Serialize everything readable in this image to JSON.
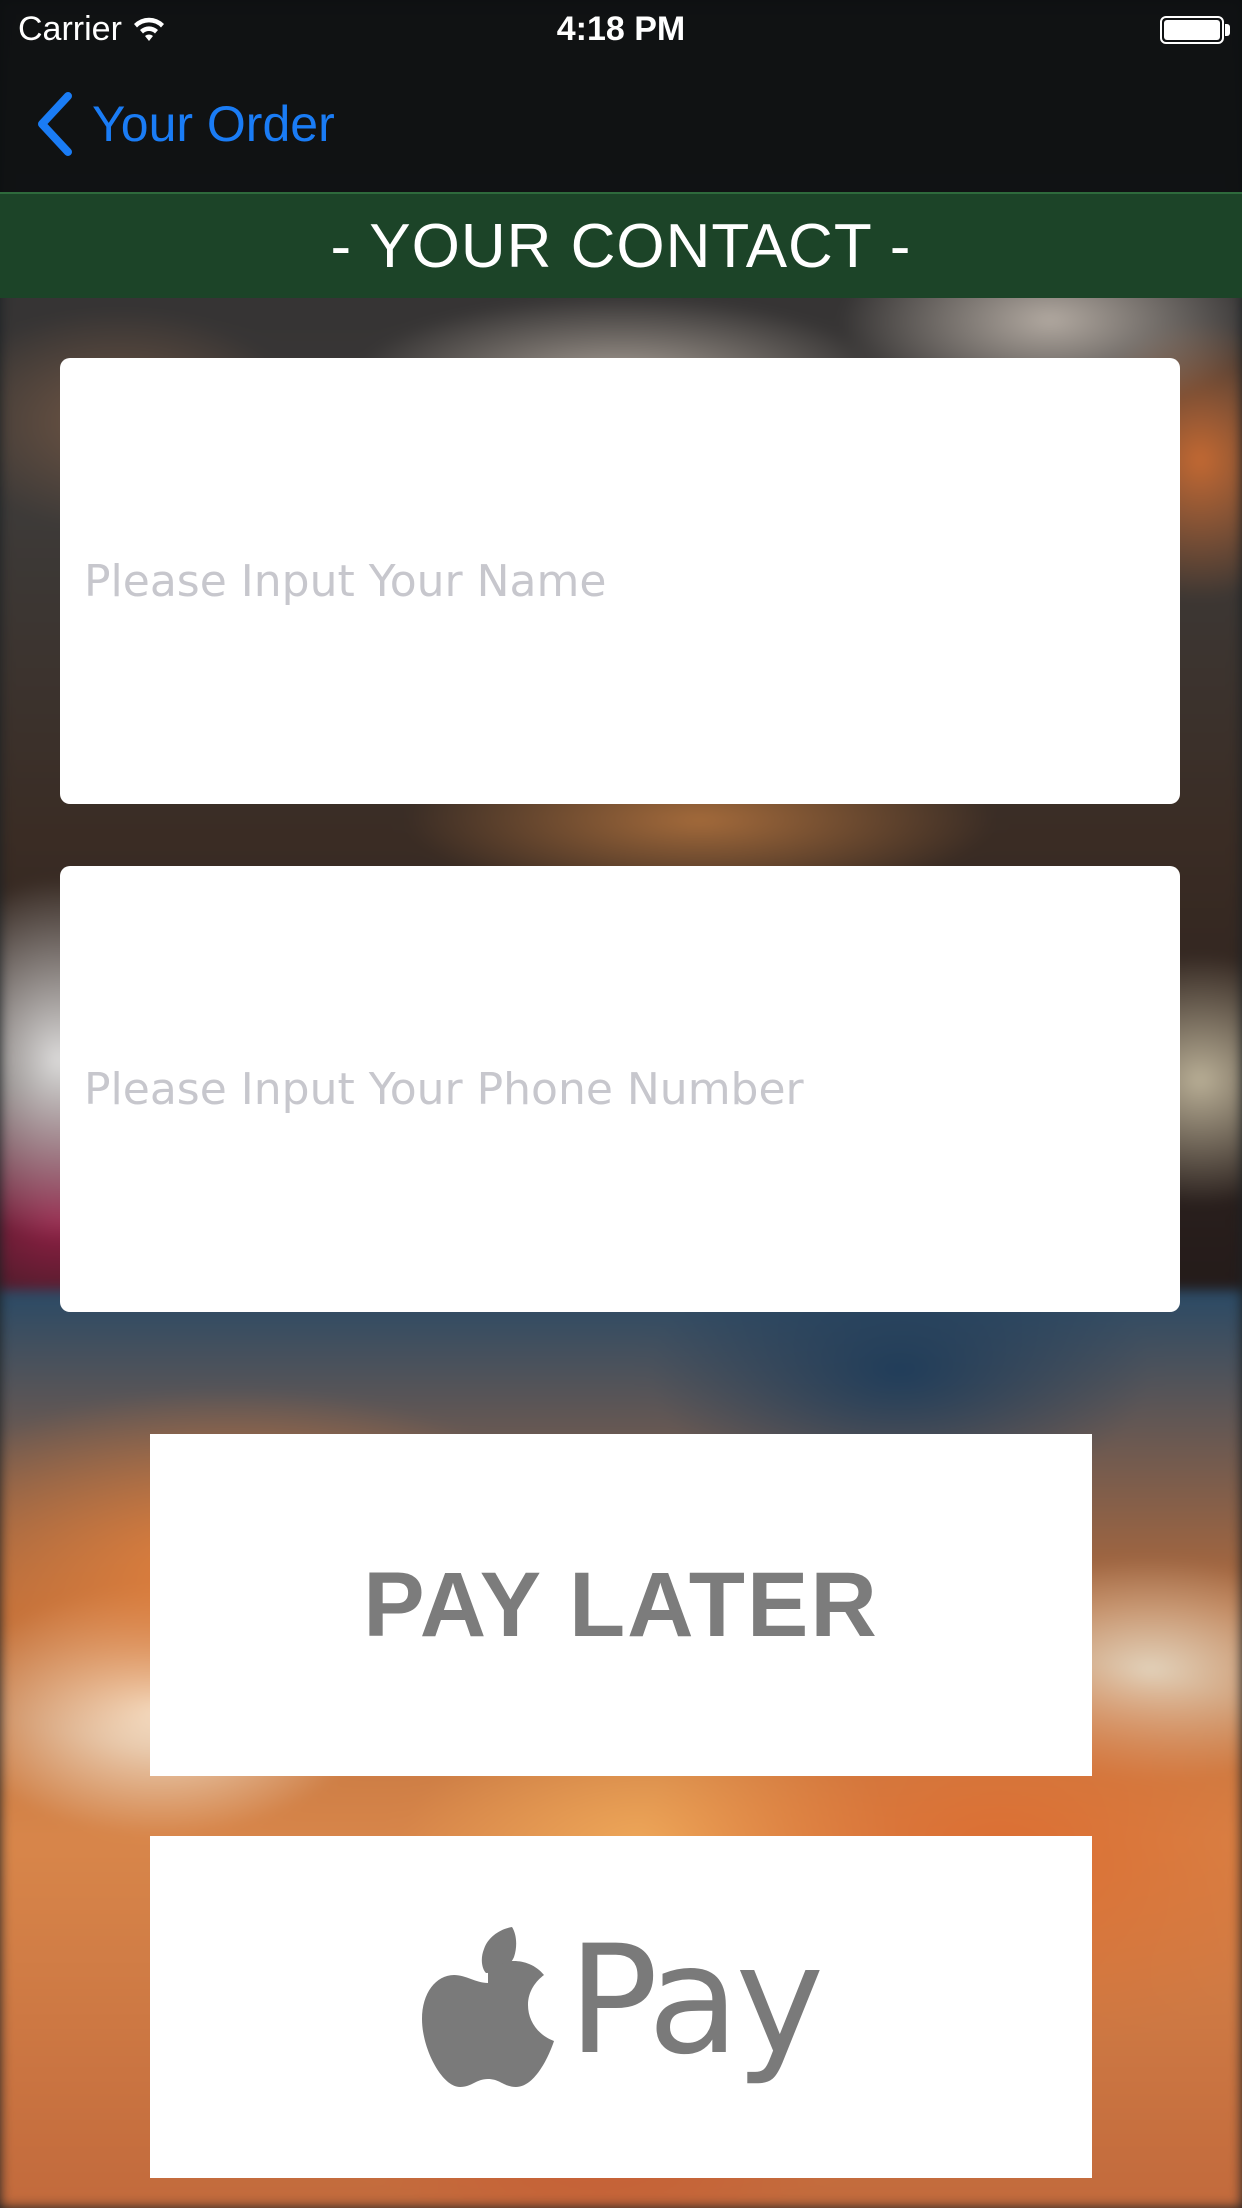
{
  "status_bar": {
    "carrier": "Carrier",
    "time": "4:18 PM"
  },
  "nav": {
    "back_label": "Your Order"
  },
  "section": {
    "title": "- YOUR CONTACT -"
  },
  "form": {
    "name_placeholder": "Please Input Your Name",
    "phone_placeholder": "Please Input Your Phone Number"
  },
  "actions": {
    "pay_later_label": "PAY LATER",
    "apple_pay_label": "Pay"
  },
  "colors": {
    "accent_blue": "#1a7cf5",
    "header_green": "#1c4428",
    "button_text_gray": "#7c7c7c"
  },
  "icons": {
    "back": "chevron-left-icon",
    "wifi": "wifi-icon",
    "battery": "battery-icon",
    "apple": "apple-logo-icon"
  }
}
